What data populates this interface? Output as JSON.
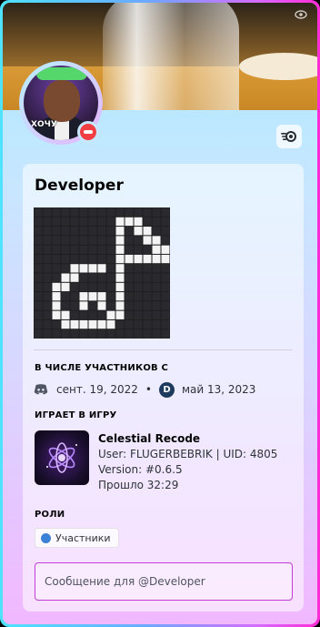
{
  "banner": {
    "icon": "eye-icon"
  },
  "avatar": {
    "caption": "ХОЧУ",
    "status": "dnd"
  },
  "nitro_badge": {
    "icon": "nitro-boost-icon"
  },
  "profile": {
    "username": "Developer",
    "member_since_title": "В ЧИСЛЕ УЧАСТНИКОВ С",
    "discord_since": "сент. 19, 2022",
    "server_icon_letter": "D",
    "server_since": "май 13, 2023"
  },
  "activity": {
    "title": "ИГРАЕТ В ИГРУ",
    "game_name": "Celestial Recode",
    "details": "User: FLUGERBEBRIK | UID: 4805",
    "version": "Version: #0.6.5",
    "elapsed": "Прошло 32:29"
  },
  "roles": {
    "title": "РОЛИ",
    "items": [
      {
        "name": "Участники",
        "color": "#3b82d6"
      }
    ]
  },
  "message": {
    "placeholder": "Сообщение для @Developer"
  },
  "colors": {
    "accent_border": "#c33dd8",
    "dnd": "#f23f43",
    "gradient_start": "#4ee3ff",
    "gradient_end": "#ff2bd6"
  }
}
